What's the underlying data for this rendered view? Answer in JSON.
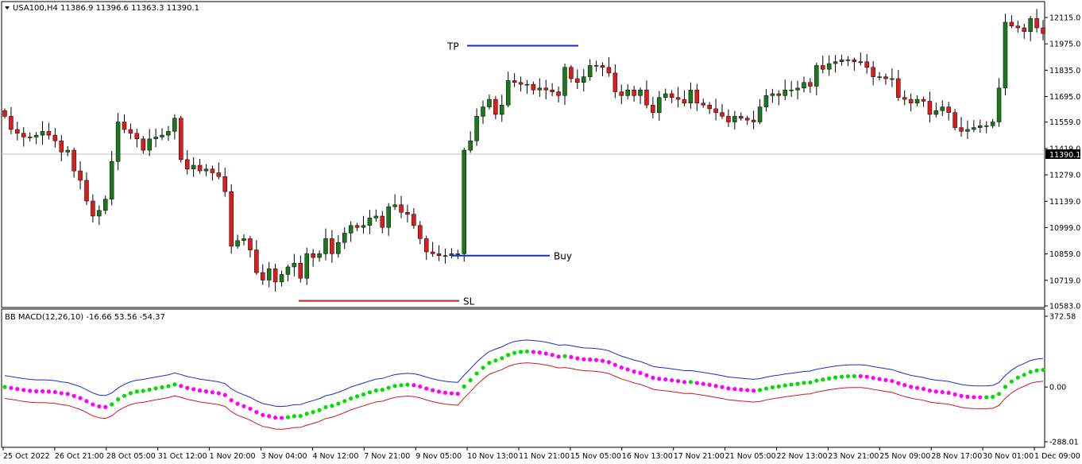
{
  "main_panel": {
    "symbol": "USA100,H4",
    "ohlc": "11386.9 11396.6 11363.3 11390.1",
    "current_price": "11390.1",
    "bull_color": "#1a7a1a",
    "bear_color": "#e01b1b"
  },
  "indicator_panel": {
    "title": "BB MACD(12,26,10) -16.66 53.56 -54.37"
  },
  "chart_data": [
    {
      "type": "candlestick",
      "ylim": [
        10583,
        12200
      ],
      "y_ticks": [
        "12115.0",
        "11975.0",
        "11835.0",
        "11695.0",
        "11559.0",
        "11419.0",
        "11279.0",
        "11139.0",
        "10999.0",
        "10859.0",
        "10719.0",
        "10583.0"
      ],
      "x_ticks": [
        "25 Oct 2022",
        "26 Oct 21:00",
        "28 Oct 05:00",
        "31 Oct 12:00",
        "1 Nov 20:00",
        "3 Nov 04:00",
        "4 Nov 12:00",
        "7 Nov 21:00",
        "9 Nov 05:00",
        "10 Nov 13:00",
        "11 Nov 21:00",
        "15 Nov 05:00",
        "16 Nov 13:00",
        "17 Nov 21:00",
        "21 Nov 05:00",
        "22 Nov 13:00",
        "23 Nov 21:00",
        "25 Nov 09:00",
        "28 Nov 17:00",
        "30 Nov 01:00",
        "1 Dec 09:00"
      ],
      "annotations": [
        {
          "label": "TP",
          "price": 11965,
          "color": "#1530c8"
        },
        {
          "label": "Buy",
          "price": 10850,
          "color": "#1530c8"
        },
        {
          "label": "SL",
          "price": 10610,
          "color": "#d01818"
        }
      ],
      "close": [
        11590,
        11520,
        11500,
        11480,
        11480,
        11490,
        11510,
        11490,
        11460,
        11400,
        11410,
        11300,
        11250,
        11140,
        11060,
        11090,
        11150,
        11350,
        11560,
        11520,
        11500,
        11470,
        11410,
        11470,
        11480,
        11490,
        11510,
        11580,
        11360,
        11310,
        11330,
        11300,
        11310,
        11290,
        11270,
        11190,
        10900,
        10930,
        10940,
        10880,
        10760,
        10720,
        10780,
        10710,
        10750,
        10790,
        10810,
        10730,
        10860,
        10840,
        10860,
        10940,
        10860,
        10920,
        10970,
        11010,
        11000,
        11010,
        11050,
        11060,
        11000,
        11110,
        11120,
        11080,
        11070,
        11010,
        10940,
        10870,
        10860,
        10850,
        10850,
        10860,
        10860,
        11410,
        11460,
        11590,
        11640,
        11680,
        11600,
        11650,
        11780,
        11770,
        11760,
        11760,
        11730,
        11740,
        11730,
        11720,
        11700,
        11850,
        11790,
        11770,
        11800,
        11860,
        11860,
        11850,
        11820,
        11720,
        11700,
        11730,
        11700,
        11730,
        11650,
        11610,
        11690,
        11710,
        11690,
        11680,
        11660,
        11730,
        11660,
        11650,
        11630,
        11610,
        11590,
        11560,
        11590,
        11580,
        11570,
        11560,
        11640,
        11700,
        11710,
        11700,
        11730,
        11730,
        11740,
        11770,
        11750,
        11860,
        11840,
        11870,
        11880,
        11890,
        11890,
        11880,
        11880,
        11850,
        11800,
        11800,
        11790,
        11790,
        11690,
        11680,
        11660,
        11680,
        11670,
        11600,
        11620,
        11640,
        11610,
        11530,
        11510,
        11520,
        11530,
        11540,
        11540,
        11560,
        11740,
        12090,
        12070,
        12060,
        12040,
        12110,
        12060,
        12030
      ]
    },
    {
      "type": "line",
      "ylim": [
        -288.01,
        372.58
      ],
      "y_ticks": [
        "372.58",
        "0.00",
        "-288.01"
      ],
      "series_colors": {
        "upper": "#1530c8",
        "lower": "#d01818",
        "up_dots": "#00e000",
        "down_dots": "#ff00ff"
      }
    }
  ]
}
